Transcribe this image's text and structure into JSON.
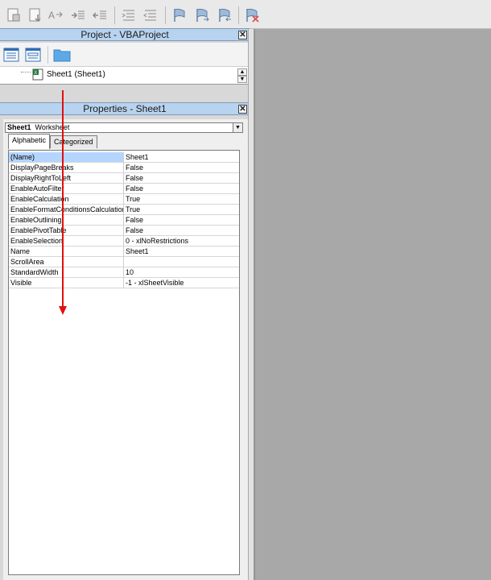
{
  "toolbar": {
    "buttons": [
      "indent-icon",
      "outdent-icon",
      "comment-block-icon",
      "uncomment-block-icon",
      "toggle-bookmark-icon",
      "next-bookmark-icon",
      "previous-bookmark-icon",
      "clear-bookmarks-icon"
    ]
  },
  "project": {
    "title": "Project - VBAProject",
    "close": "✕",
    "tree_item": "Sheet1 (Sheet1)"
  },
  "properties": {
    "title": "Properties - Sheet1",
    "close": "✕",
    "object_name": "Sheet1",
    "object_type": "Worksheet",
    "tabs": [
      "Alphabetic",
      "Categorized"
    ],
    "rows": [
      {
        "key": "(Name)",
        "value": "Sheet1"
      },
      {
        "key": "DisplayPageBreaks",
        "value": "False"
      },
      {
        "key": "DisplayRightToLeft",
        "value": "False"
      },
      {
        "key": "EnableAutoFilter",
        "value": "False"
      },
      {
        "key": "EnableCalculation",
        "value": "True"
      },
      {
        "key": "EnableFormatConditionsCalculation",
        "value": "True"
      },
      {
        "key": "EnableOutlining",
        "value": "False"
      },
      {
        "key": "EnablePivotTable",
        "value": "False"
      },
      {
        "key": "EnableSelection",
        "value": "0 - xlNoRestrictions"
      },
      {
        "key": "Name",
        "value": "Sheet1"
      },
      {
        "key": "ScrollArea",
        "value": ""
      },
      {
        "key": "StandardWidth",
        "value": "10"
      },
      {
        "key": "Visible",
        "value": "-1 - xlSheetVisible"
      }
    ]
  },
  "colors": {
    "annotation_arrow": "#e01010",
    "title_bar": "#b8d3ef",
    "selected_row": "#b4d5fe"
  }
}
